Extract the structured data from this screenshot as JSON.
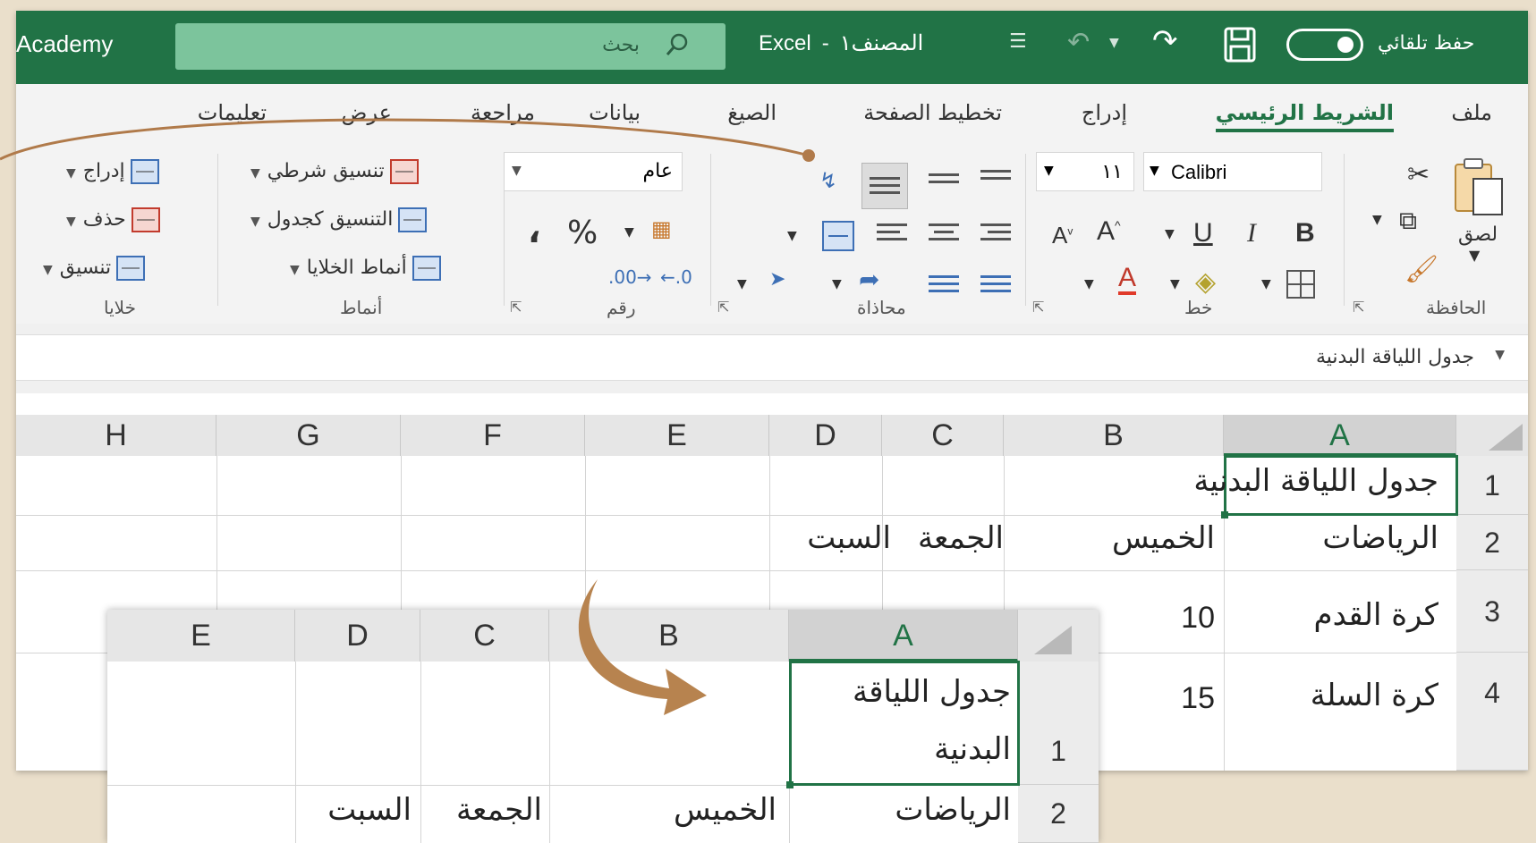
{
  "titlebar": {
    "brand": "Academy",
    "search_placeholder": "بحث",
    "app": "Excel",
    "separator": "-",
    "workbook": "المصنف١",
    "autosave_label": "حفظ تلقائي"
  },
  "ribbon_tabs": [
    {
      "label": "ملف"
    },
    {
      "label": "الشريط الرئيسي"
    },
    {
      "label": "إدراج"
    },
    {
      "label": "تخطيط الصفحة"
    },
    {
      "label": "الصيغ"
    },
    {
      "label": "بيانات"
    },
    {
      "label": "مراجعة"
    },
    {
      "label": "عرض"
    },
    {
      "label": "تعليمات"
    }
  ],
  "ribbon": {
    "clipboard": {
      "label": "الحافظة",
      "paste": "لصق"
    },
    "font": {
      "label": "خط",
      "name": "Calibri",
      "size": "١١",
      "bold": "B",
      "italic": "I",
      "underline": "U"
    },
    "alignment": {
      "label": "محاذاة"
    },
    "number": {
      "label": "رقم",
      "format": "عام"
    },
    "styles": {
      "label": "أنماط",
      "conditional": "تنسيق شرطي",
      "as_table": "التنسيق كجدول",
      "cell_styles": "أنماط الخلايا"
    },
    "cells": {
      "label": "خلايا",
      "insert": "إدراج",
      "delete": "حذف",
      "format": "تنسيق"
    }
  },
  "formula_bar": {
    "content": "جدول اللياقة البدنية"
  },
  "sheet": {
    "columns": [
      "A",
      "B",
      "C",
      "D",
      "E",
      "F",
      "G",
      "H"
    ],
    "rows": [
      "1",
      "2",
      "3",
      "4"
    ],
    "selected_cell": "A1",
    "cells": {
      "A1": "جدول اللياقة البدنية",
      "A2": "الرياضات",
      "B2": "الخميس",
      "C2": "الجمعة",
      "D2": "السبت",
      "A3": "كرة القدم",
      "B3": "10",
      "A4": "كرة السلة",
      "B4": "15"
    }
  },
  "inset_sheet": {
    "columns": [
      "A",
      "B",
      "C",
      "D",
      "E"
    ],
    "rows": [
      "1",
      "2"
    ],
    "cells": {
      "A1_line1": "جدول اللياقة",
      "A1_line2": "البدنية",
      "A2": "الرياضات",
      "B2": "الخميس",
      "C2": "الجمعة",
      "D2": "السبت"
    }
  },
  "colors": {
    "excel_green": "#217346",
    "search_green": "#7cc49c",
    "annotation": "#b07a4a",
    "backdrop": "#eadfcb"
  }
}
